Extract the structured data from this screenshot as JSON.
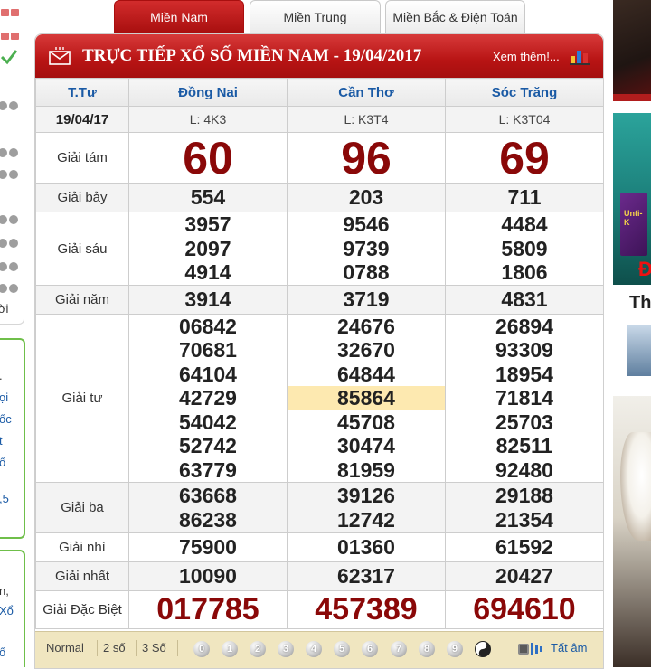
{
  "tabs": [
    "Miền Nam",
    "Miền Trung",
    "Miền Bắc & Điện Toán"
  ],
  "header": {
    "title": "TRỰC TIẾP XỔ SỐ MIỀN NAM - 19/04/2017",
    "more": "Xem thêm!..."
  },
  "table": {
    "col_label": "T.Tư",
    "date": "19/04/17",
    "provinces": [
      {
        "name": "Đồng Nai",
        "code": "L: 4K3"
      },
      {
        "name": "Cần Thơ",
        "code": "L: K3T4"
      },
      {
        "name": "Sóc Trăng",
        "code": "L: K3T04"
      }
    ],
    "prizes": [
      {
        "label": "Giải tám",
        "values": [
          [
            "60"
          ],
          [
            "96"
          ],
          [
            "69"
          ]
        ]
      },
      {
        "label": "Giải bảy",
        "values": [
          [
            "554"
          ],
          [
            "203"
          ],
          [
            "711"
          ]
        ]
      },
      {
        "label": "Giải sáu",
        "values": [
          [
            "3957",
            "2097",
            "4914"
          ],
          [
            "9546",
            "9739",
            "0788"
          ],
          [
            "4484",
            "5809",
            "1806"
          ]
        ]
      },
      {
        "label": "Giải năm",
        "values": [
          [
            "3914"
          ],
          [
            "3719"
          ],
          [
            "4831"
          ]
        ]
      },
      {
        "label": "Giải tư",
        "values": [
          [
            "06842",
            "70681",
            "64104",
            "42729",
            "54042",
            "52742",
            "63779"
          ],
          [
            "24676",
            "32670",
            "64844",
            "85864",
            "45708",
            "30474",
            "81959"
          ],
          [
            "26894",
            "93309",
            "18954",
            "71814",
            "25703",
            "82511",
            "92480"
          ]
        ]
      },
      {
        "label": "Giải ba",
        "values": [
          [
            "63668",
            "86238"
          ],
          [
            "39126",
            "12742"
          ],
          [
            "29188",
            "21354"
          ]
        ]
      },
      {
        "label": "Giải nhì",
        "values": [
          [
            "75900"
          ],
          [
            "01360"
          ],
          [
            "61592"
          ]
        ]
      },
      {
        "label": "Giải nhất",
        "values": [
          [
            "10090"
          ],
          [
            "62317"
          ],
          [
            "20427"
          ]
        ]
      },
      {
        "label": "Giải Đặc Biệt",
        "values": [
          [
            "017785"
          ],
          [
            "457389"
          ],
          [
            "694610"
          ]
        ]
      }
    ]
  },
  "bottom_bar": {
    "modes": [
      "Normal",
      "2 số",
      "3 Số"
    ],
    "digits": [
      "0",
      "1",
      "2",
      "3",
      "4",
      "5",
      "6",
      "7",
      "8",
      "9"
    ],
    "all_label": "Tất âm"
  },
  "left_strip": {
    "texts_a": [
      ".",
      "ọi",
      "ốc",
      "t",
      "ố",
      ",5"
    ],
    "text_top": "ời",
    "texts_b": [
      "n,",
      "Xổ",
      "ố"
    ]
  },
  "right_strip": {
    "ad2_box": "Unti-K",
    "ad2_red": "Đ",
    "th": "Th"
  },
  "colors": {
    "brand_red": "#b81414",
    "number_red": "#8a0808",
    "header_blue": "#1a5aa5",
    "highlight": "#fde9b0"
  }
}
